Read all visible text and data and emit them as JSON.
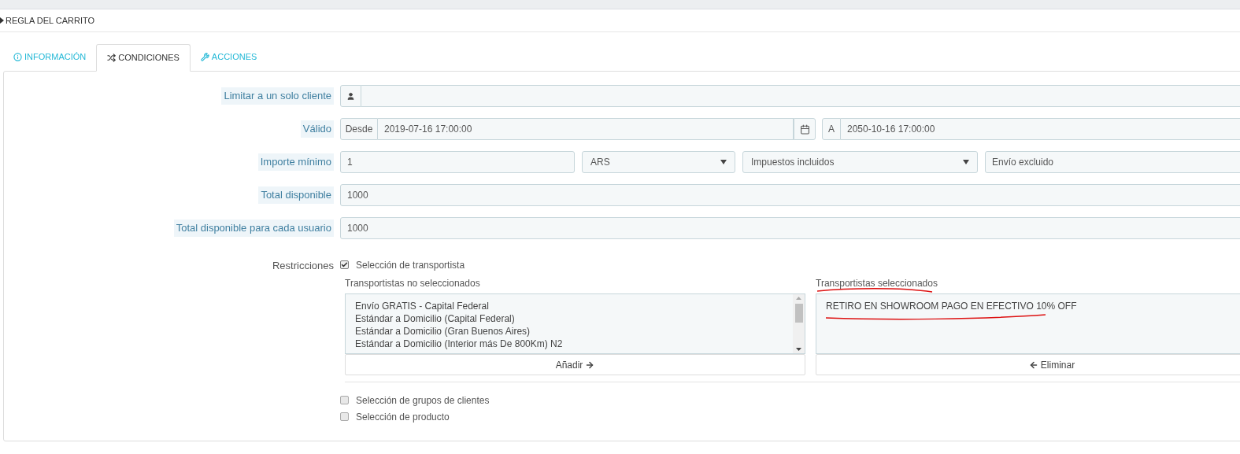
{
  "panel_title": "REGLA DEL CARRITO",
  "tabs": [
    {
      "label": "INFORMACIÓN",
      "selected": false
    },
    {
      "label": "CONDICIONES",
      "selected": true
    },
    {
      "label": "ACCIONES",
      "selected": false
    }
  ],
  "customer": {
    "label": "Limitar a un solo cliente"
  },
  "valid": {
    "label": "Válido",
    "from_label": "Desde",
    "from": "2019-07-16 17:00:00",
    "to_label": "A",
    "to": "2050-10-16 17:00:00"
  },
  "minimum": {
    "label": "Importe mínimo",
    "amount": "1",
    "currency": "ARS",
    "tax": "Impuestos incluidos",
    "shipping": "Envío excluido"
  },
  "total_available": {
    "label": "Total disponible",
    "value": "1000"
  },
  "total_per_user": {
    "label": "Total disponible para cada usuario",
    "value": "1000"
  },
  "restrictions": {
    "label": "Restricciones",
    "options": [
      {
        "label": "Selección de transportista",
        "checked": true
      },
      {
        "label": "Selección de grupos de clientes",
        "checked": false
      },
      {
        "label": "Selección de producto",
        "checked": false
      }
    ]
  },
  "carriers": {
    "unselected_title": "Transportistas no seleccionados",
    "unselected": [
      "Envío GRATIS - Capital Federal",
      "Estándar a Domicilio (Capital Federal)",
      "Estándar a Domicilio (Gran Buenos Aires)",
      "Estándar a Domicilio (Interior más De 800Km) N2"
    ],
    "add_button": "Añadir",
    "selected_title": "Transportistas seleccionados",
    "selected": [
      "RETIRO EN SHOWROOM PAGO EN EFECTIVO 10% OFF"
    ],
    "remove_button": "Eliminar"
  }
}
